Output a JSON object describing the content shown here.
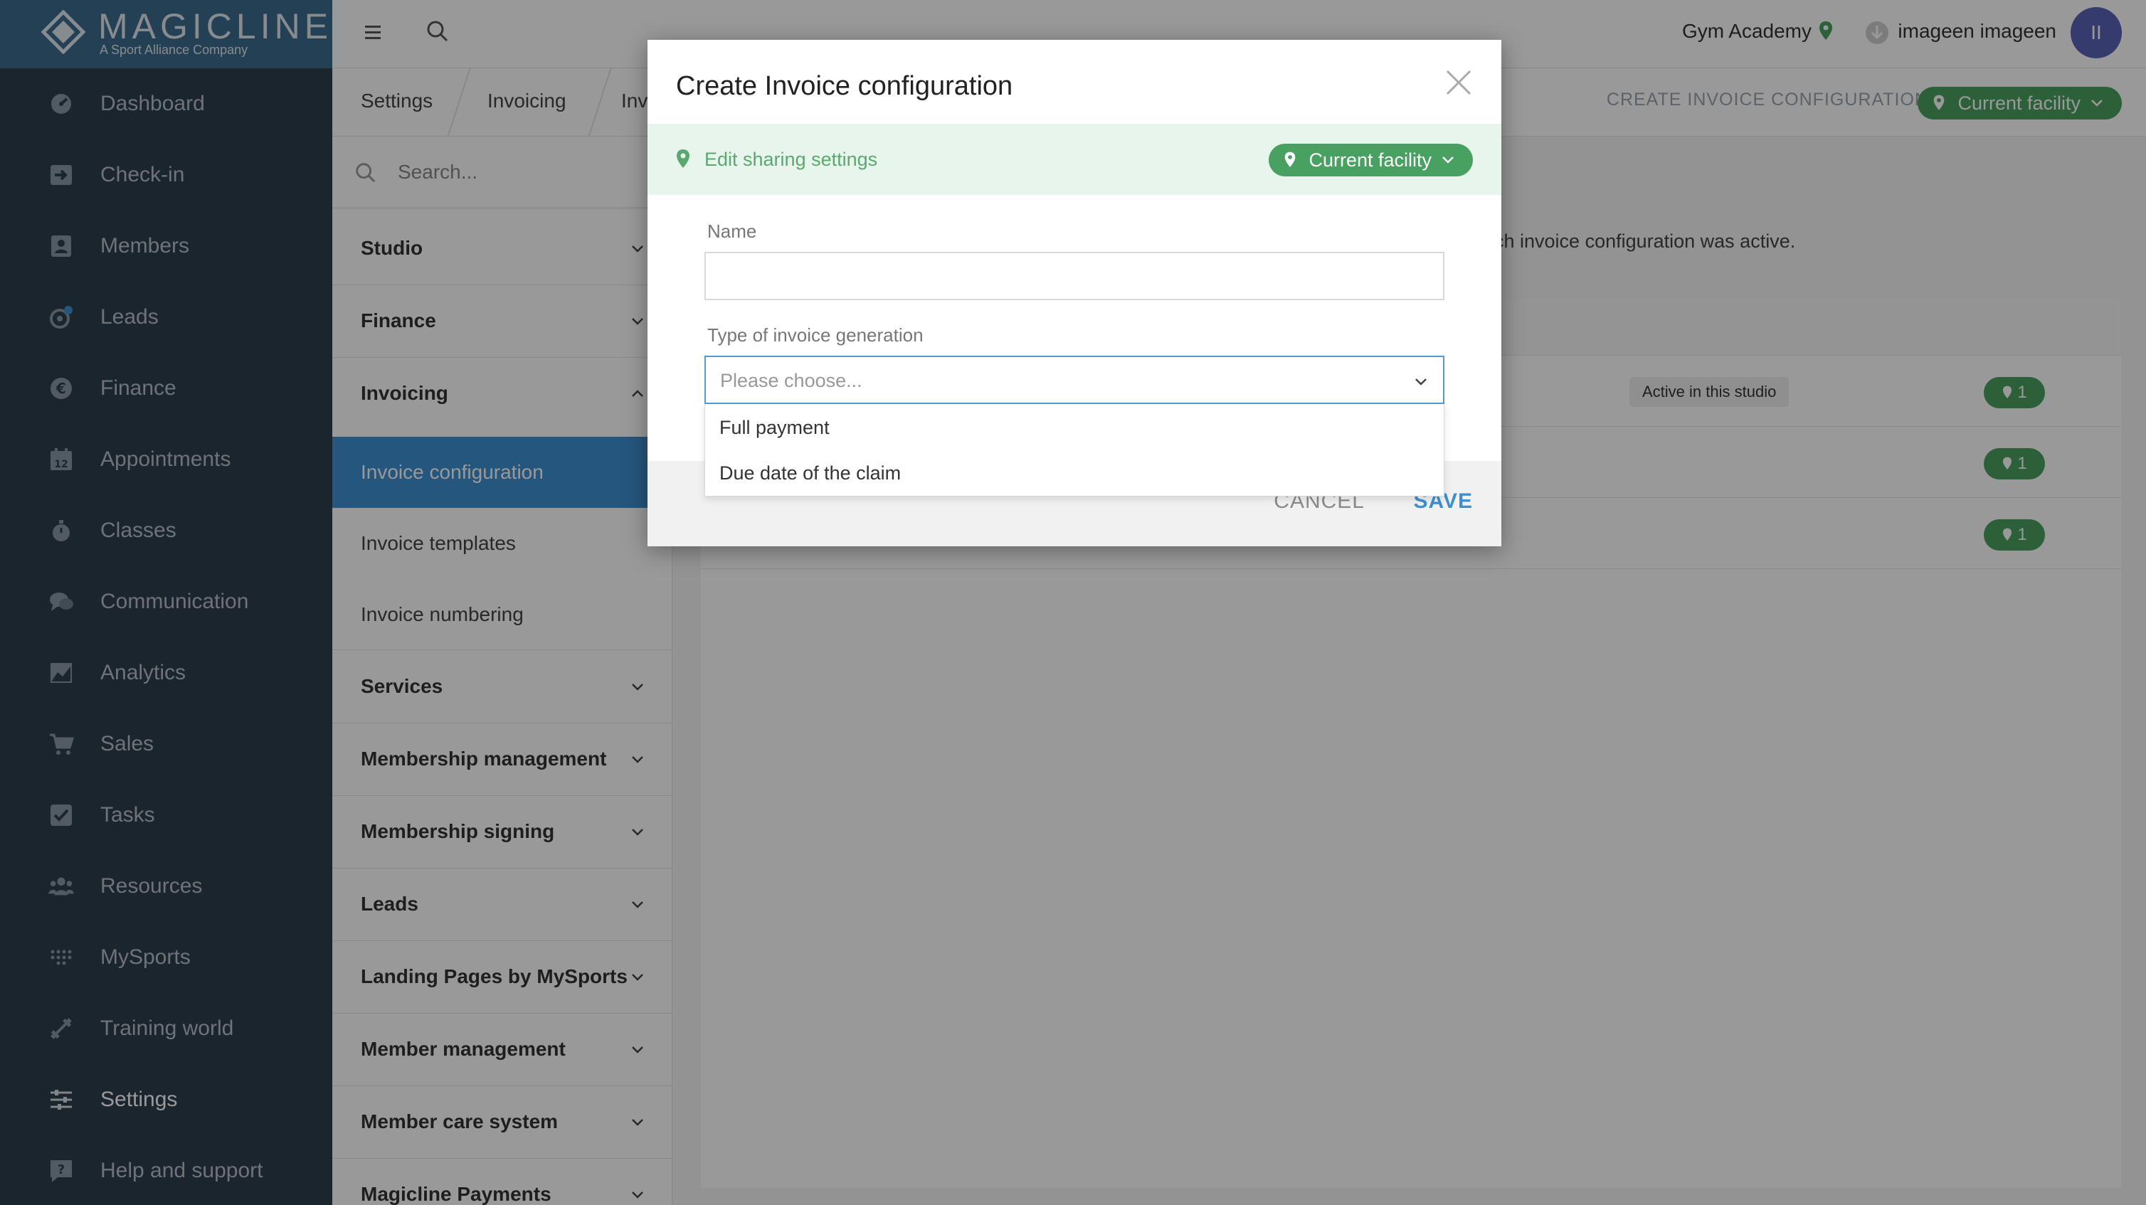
{
  "brand": {
    "name": "MAGICLINE",
    "tagline": "A Sport Alliance Company"
  },
  "nav": {
    "items": [
      {
        "label": "Dashboard",
        "icon": "dashboard-icon"
      },
      {
        "label": "Check-in",
        "icon": "check-in-icon"
      },
      {
        "label": "Members",
        "icon": "members-icon"
      },
      {
        "label": "Leads",
        "icon": "leads-icon"
      },
      {
        "label": "Finance",
        "icon": "finance-icon"
      },
      {
        "label": "Appointments",
        "icon": "calendar-icon"
      },
      {
        "label": "Classes",
        "icon": "stopwatch-icon"
      },
      {
        "label": "Communication",
        "icon": "chat-icon"
      },
      {
        "label": "Analytics",
        "icon": "chart-icon"
      },
      {
        "label": "Sales",
        "icon": "cart-icon"
      },
      {
        "label": "Tasks",
        "icon": "checkbox-icon"
      },
      {
        "label": "Resources",
        "icon": "people-icon"
      },
      {
        "label": "MySports",
        "icon": "dots-grid-icon"
      },
      {
        "label": "Training world",
        "icon": "dumbbell-icon"
      },
      {
        "label": "Settings",
        "icon": "sliders-icon"
      },
      {
        "label": "Help and support",
        "icon": "help-icon"
      }
    ],
    "active": "Settings"
  },
  "topbar": {
    "gym": "Gym Academy",
    "user": "imageen imageen",
    "avatar_initials": "II"
  },
  "breadcrumb": {
    "items": [
      "Settings",
      "Invoicing",
      "Inv"
    ],
    "create_label": "CREATE INVOICE CONFIGURATION",
    "facility_label": "Current facility"
  },
  "settings": {
    "search_placeholder": "Search...",
    "sections": [
      {
        "label": "Studio"
      },
      {
        "label": "Finance"
      },
      {
        "label": "Invoicing",
        "expanded": true
      },
      {
        "label": "Services"
      },
      {
        "label": "Membership management"
      },
      {
        "label": "Membership signing"
      },
      {
        "label": "Leads"
      },
      {
        "label": "Landing Pages by MySports"
      },
      {
        "label": "Member management"
      },
      {
        "label": "Member care system"
      },
      {
        "label": "Magicline Payments"
      }
    ],
    "subitems": [
      {
        "label": "Invoice configuration",
        "active": true
      },
      {
        "label": "Invoice templates"
      },
      {
        "label": "Invoice numbering"
      }
    ]
  },
  "main": {
    "description_tail": "ch invoice configuration was active.",
    "rows": [
      {
        "badge": "Active in this studio",
        "count": "1"
      },
      {
        "badge": "",
        "count": "1"
      },
      {
        "badge": "",
        "count": "1"
      }
    ]
  },
  "modal": {
    "title": "Create Invoice configuration",
    "share_label": "Edit sharing settings",
    "share_scope": "Current facility",
    "name_label": "Name",
    "name_value": "",
    "type_label": "Type of invoice generation",
    "type_placeholder": "Please choose...",
    "options": [
      "Full payment",
      "Due date of the claim"
    ],
    "cancel_label": "CANCEL",
    "save_label": "SAVE"
  },
  "colors": {
    "nav_bg": "#2d3e4c",
    "logo_bg": "#3d6b8e",
    "accent_blue": "#3e8fd0",
    "accent_green": "#48a160",
    "avatar": "#5a63b7"
  }
}
